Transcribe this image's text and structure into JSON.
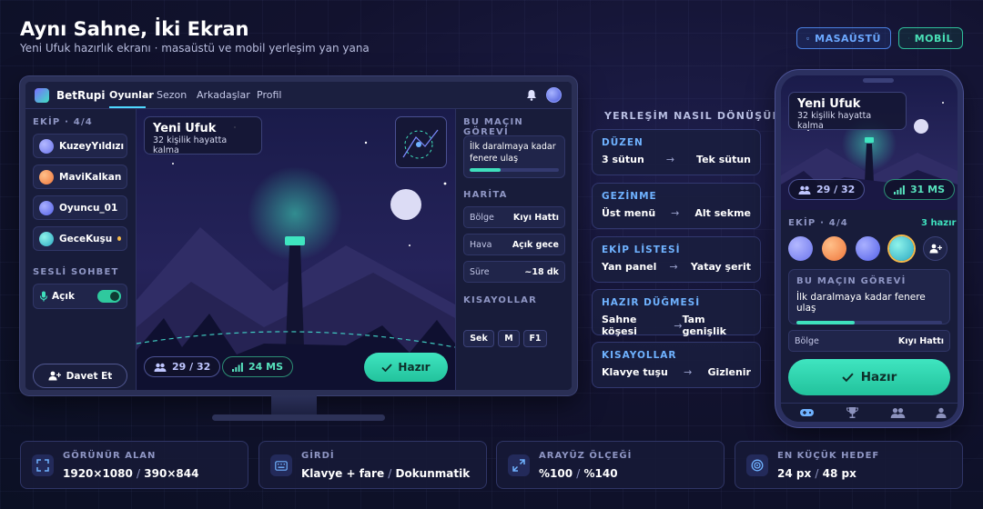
{
  "header": {
    "title": "Aynı Sahne, İki Ekran",
    "subtitle": "Yeni Ufuk hazırlık ekranı · masaüstü ve mobil yerleşim yan yana",
    "view_desktop": "MASAÜSTÜ",
    "view_mobile": "MOBİL"
  },
  "desktop": {
    "brand": "BetRupi",
    "nav": [
      "Oyunlar",
      "Sezon",
      "Arkadaşlar",
      "Profil"
    ],
    "team_label": "EKİP · 4/4",
    "team": [
      {
        "name": "KuzeyYıldızı",
        "color": "#7c83ff",
        "status": "#3fe0bd"
      },
      {
        "name": "MaviKalkan",
        "color": "#ff9a55",
        "status": "#3fe0bd"
      },
      {
        "name": "Oyuncu_01",
        "color": "#6f7bff",
        "status": "#3fe0bd"
      },
      {
        "name": "GeceKuşu",
        "color": "#3fd6cf",
        "status": "#f2b84b"
      }
    ],
    "voice_label": "SESLİ SOHBET",
    "voice_state": "Açık",
    "invite": "Davet Et",
    "scene_title": "Yeni Ufuk",
    "scene_sub": "32 kişilik hayatta kalma",
    "players": "29 / 32",
    "ping": "24 MS",
    "ready": "Hazır",
    "task_label": "BU MAÇIN GÖREVİ",
    "task_text": "İlk daralmaya kadar fenere ulaş",
    "task_progress": 0.35,
    "map_label": "HARİTA",
    "map_rows": [
      {
        "k": "Bölge",
        "v": "Kıyı Hattı"
      },
      {
        "k": "Hava",
        "v": "Açık gece"
      },
      {
        "k": "Süre",
        "v": "~18 dk"
      }
    ],
    "shortcuts_label": "KISAYOLLAR",
    "shortcuts": [
      "Sek",
      "M",
      "F1"
    ]
  },
  "transform": {
    "title": "YERLEŞİM NASIL DÖNÜŞÜR?",
    "items": [
      {
        "h": "DÜZEN",
        "from": "3 sütun",
        "to": "Tek sütun"
      },
      {
        "h": "GEZİNME",
        "from": "Üst menü",
        "to": "Alt sekme"
      },
      {
        "h": "EKİP LİSTESİ",
        "from": "Yan panel",
        "to": "Yatay şerit"
      },
      {
        "h": "HAZIR DÜĞMESİ",
        "from": "Sahne köşesi",
        "to": "Tam genişlik"
      },
      {
        "h": "KISAYOLLAR",
        "from": "Klavye tuşu",
        "to": "Gizlenir"
      }
    ],
    "arrow": "→"
  },
  "mobile": {
    "scene_title": "Yeni Ufuk",
    "scene_sub": "32 kişilik hayatta kalma",
    "players": "29 / 32",
    "ping": "31 MS",
    "team_label": "EKİP · 4/4",
    "team_ready": "3 hazır",
    "task_label": "BU MAÇIN GÖREVİ",
    "task_text": "İlk daralmaya kadar fenere ulaş",
    "task_progress": 0.4,
    "region_k": "Bölge",
    "region_v": "Kıyı Hattı",
    "ready": "Hazır"
  },
  "stats": [
    {
      "k": "GÖRÜNÜR ALAN",
      "v1": "1920×1080",
      "v2": "390×844",
      "icon": "expand-icon"
    },
    {
      "k": "GİRDİ",
      "v1": "Klavye + fare",
      "v2": "Dokunmatik",
      "icon": "keyboard-icon"
    },
    {
      "k": "ARAYÜZ ÖLÇEĞİ",
      "v1": "%100",
      "v2": "%140",
      "icon": "scale-icon"
    },
    {
      "k": "EN KÜÇÜK HEDEF",
      "v1": "24 px",
      "v2": "48 px",
      "icon": "target-icon"
    }
  ],
  "slash": "/",
  "colors": {
    "accent": "#3fe0bd",
    "blue": "#6fb2ff",
    "bg": "#12122e"
  }
}
